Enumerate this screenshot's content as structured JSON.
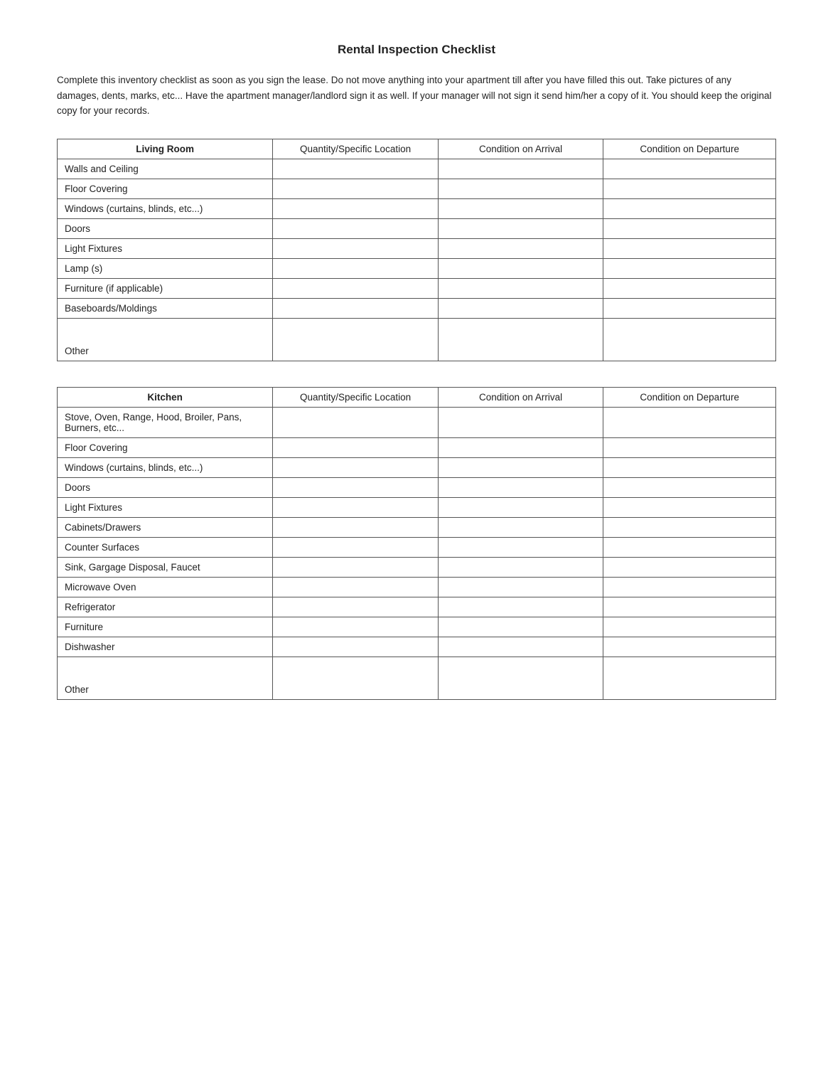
{
  "page": {
    "title": "Rental Inspection Checklist",
    "intro": "Complete this inventory checklist as soon as you sign the lease.  Do not move anything into your apartment till after you have filled this out.  Take pictures of any damages, dents, marks, etc... Have the apartment manager/landlord sign it as well.  If your manager will not sign it send him/her a copy of it.  You should keep the original copy for your records."
  },
  "living_room": {
    "section_label": "Living Room",
    "col_qty": "Quantity/Specific Location",
    "col_arrival": "Condition on Arrival",
    "col_departure": "Condition on Departure",
    "items": [
      "Walls and Ceiling",
      "Floor Covering",
      "Windows (curtains, blinds, etc...)",
      "Doors",
      "Light Fixtures",
      "Lamp (s)",
      "Furniture (if applicable)",
      "Baseboards/Moldings",
      "Other"
    ]
  },
  "kitchen": {
    "section_label": "Kitchen",
    "col_qty": "Quantity/Specific Location",
    "col_arrival": "Condition on Arrival",
    "col_departure": "Condition on Departure",
    "items": [
      "Stove, Oven, Range, Hood, Broiler, Pans, Burners, etc...",
      "Floor Covering",
      "Windows (curtains, blinds, etc...)",
      "Doors",
      "Light Fixtures",
      "Cabinets/Drawers",
      "Counter Surfaces",
      "Sink, Gargage Disposal, Faucet",
      "Microwave Oven",
      "Refrigerator",
      "Furniture",
      "Dishwasher",
      "Other"
    ]
  }
}
